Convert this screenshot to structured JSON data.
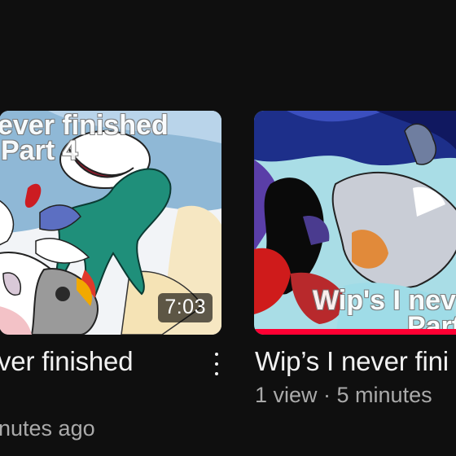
{
  "videos": [
    {
      "thumbnail_text": [
        "ever finished",
        "Part 4"
      ],
      "duration": "7:03",
      "title": "ver finished",
      "meta": "nutes ago",
      "menu_icon": "more-vert-icon"
    },
    {
      "thumbnail_text": [
        "Wip's I neve",
        "Part"
      ],
      "watched_progress": 1.0,
      "title": "Wip’s I never fini",
      "meta": "1 view · 5 minutes"
    }
  ],
  "colors": {
    "background": "#0f0f0f",
    "title_text": "#f1f1f1",
    "meta_text": "#aaaaaa",
    "progress": "#ff0033"
  }
}
